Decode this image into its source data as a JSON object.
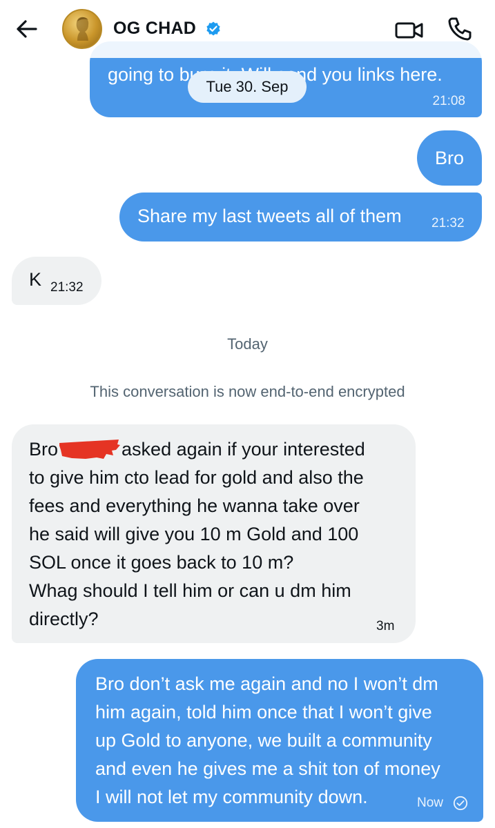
{
  "header": {
    "contact_name": "OG CHAD",
    "back_icon": "arrow-left-icon",
    "verified_icon": "verified-badge-icon",
    "video_icon": "video-camera-icon",
    "phone_icon": "phone-icon"
  },
  "colors": {
    "outgoing_bubble": "#4a98ea",
    "incoming_bubble": "#eff1f2",
    "verified_badge": "#1d9bf0",
    "redaction": "#e53424"
  },
  "date_separator_top": "Tue 30. Sep",
  "messages_top": [
    {
      "text": "going to burn it. Will send you links here.",
      "time": "21:08"
    },
    {
      "text": "Bro"
    },
    {
      "text": "Share my last tweets all of them",
      "time": "21:32"
    },
    {
      "text": "K",
      "time": "21:32"
    }
  ],
  "date_separator_today": "Today",
  "encryption_notice": "This conversation is now end-to-end encrypted",
  "incoming_long": {
    "lines": [
      "Bro",
      "asked again if your interested",
      "to give him cto lead for gold and also the",
      "fees and everything he wanna take over",
      "he said will give you 10 m Gold and 100",
      "SOL once it goes back to 10 m?",
      "Whag should I tell him or can u dm him",
      "directly?"
    ],
    "time": "3m"
  },
  "outgoing_long": {
    "lines": [
      "Bro don’t ask me again and no I won’t dm",
      "him again, told him once that I won’t give",
      "up Gold to anyone, we built a community",
      "and even he gives me a shit ton of money",
      "I will not let my community down."
    ],
    "time": "Now",
    "status_icon": "check-circle-icon"
  }
}
